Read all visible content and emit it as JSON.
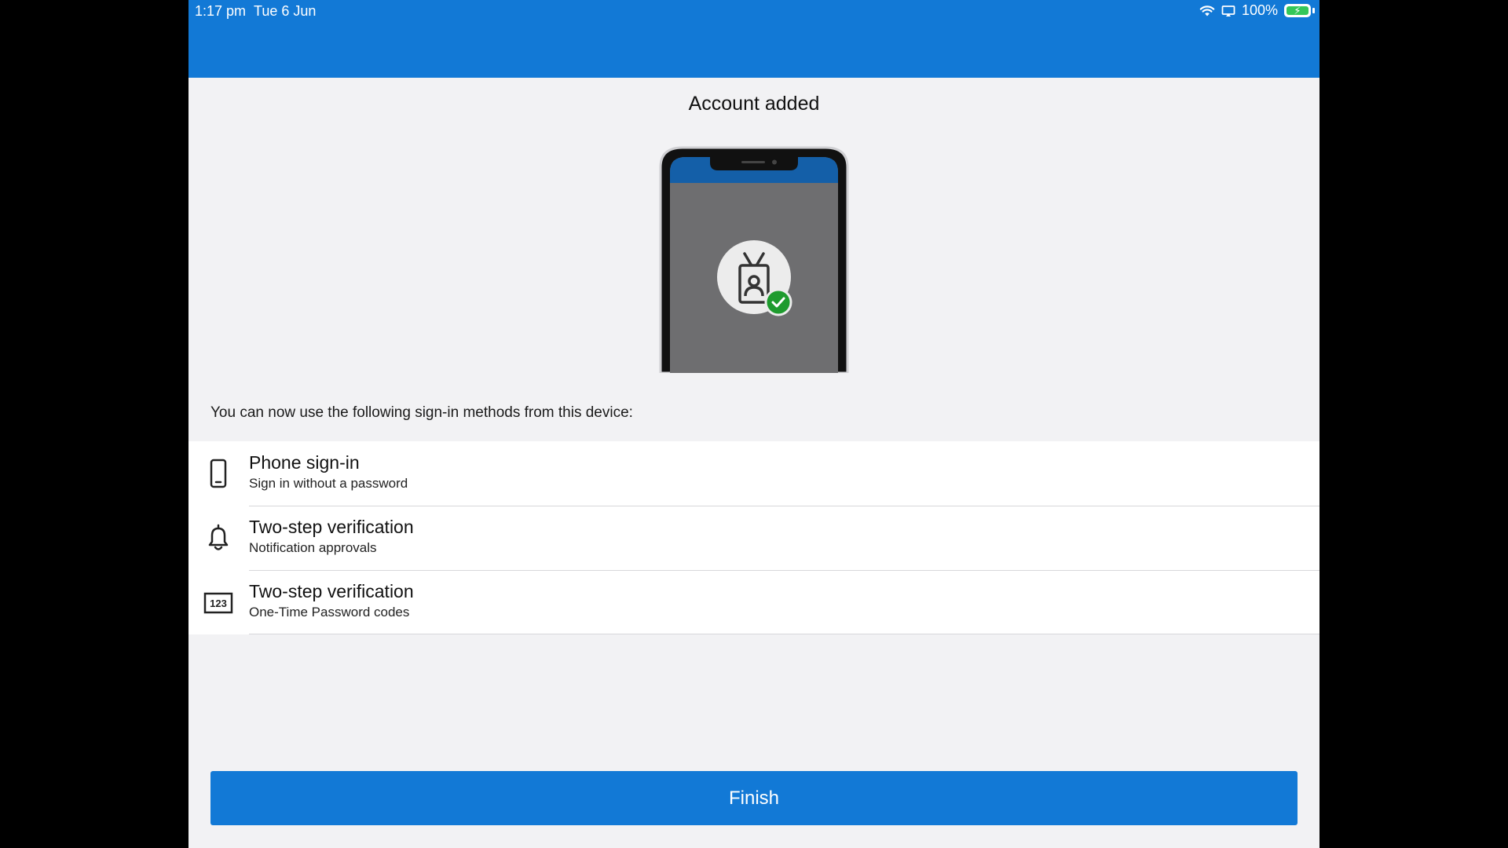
{
  "status_bar": {
    "time": "1:17 pm",
    "date": "Tue 6 Jun",
    "battery": "100%",
    "icons": [
      "wifi-icon",
      "screen-mirroring-icon",
      "battery-charging-icon"
    ]
  },
  "colors": {
    "accent": "#1279d6",
    "success": "#1e9b2e",
    "background": "#f2f2f4"
  },
  "page": {
    "title": "Account added",
    "illustration": "phone-with-badge-check-illustration",
    "intro": "You can now use the following sign-in methods from this device:"
  },
  "methods": [
    {
      "icon": "phone-icon",
      "title": "Phone sign-in",
      "subtitle": "Sign in without a password"
    },
    {
      "icon": "bell-icon",
      "title": "Two-step verification",
      "subtitle": "Notification approvals"
    },
    {
      "icon": "otp-code-icon",
      "icon_text": "123",
      "title": "Two-step verification",
      "subtitle": "One-Time Password codes"
    }
  ],
  "finish_label": "Finish"
}
